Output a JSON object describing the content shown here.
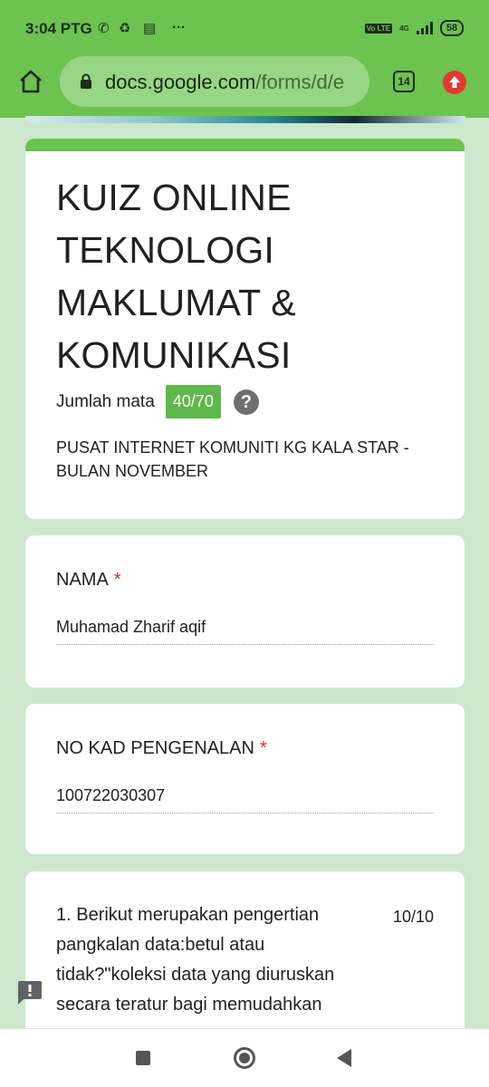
{
  "status_bar": {
    "time": "3:04 PTG",
    "network": "4G",
    "lte": "Vo LTE",
    "battery": "58",
    "icons": [
      "whatsapp-icon",
      "recycle-icon",
      "news-icon",
      "more-dots-icon"
    ]
  },
  "browser": {
    "url_host": "docs.google.com",
    "url_path": "/forms/d/e",
    "tab_count": "14",
    "accent_color": "#6cc34f"
  },
  "form": {
    "title": "KUIZ ONLINE TEKNOLOGI MAKLUMAT & KOMUNIKASI",
    "score_label": "Jumlah mata",
    "score": "40/70",
    "help": "?",
    "description": "PUSAT INTERNET KOMUNITI KG KALA STAR - BULAN NOVEMBER"
  },
  "questions": [
    {
      "label": "NAMA",
      "required": "*",
      "answer": "Muhamad Zharif aqif"
    },
    {
      "label": "NO KAD PENGENALAN",
      "required": "*",
      "answer": "100722030307"
    },
    {
      "text": "1. Berikut merupakan pengertian pangkalan data:betul atau tidak?\"koleksi data yang diuruskan secara teratur bagi memudahkan",
      "points": "10/10"
    }
  ],
  "colors": {
    "header_green": "#6cc34f",
    "page_background": "#cde7cd",
    "score_badge": "#5fb84a",
    "required_red": "#d93025"
  }
}
